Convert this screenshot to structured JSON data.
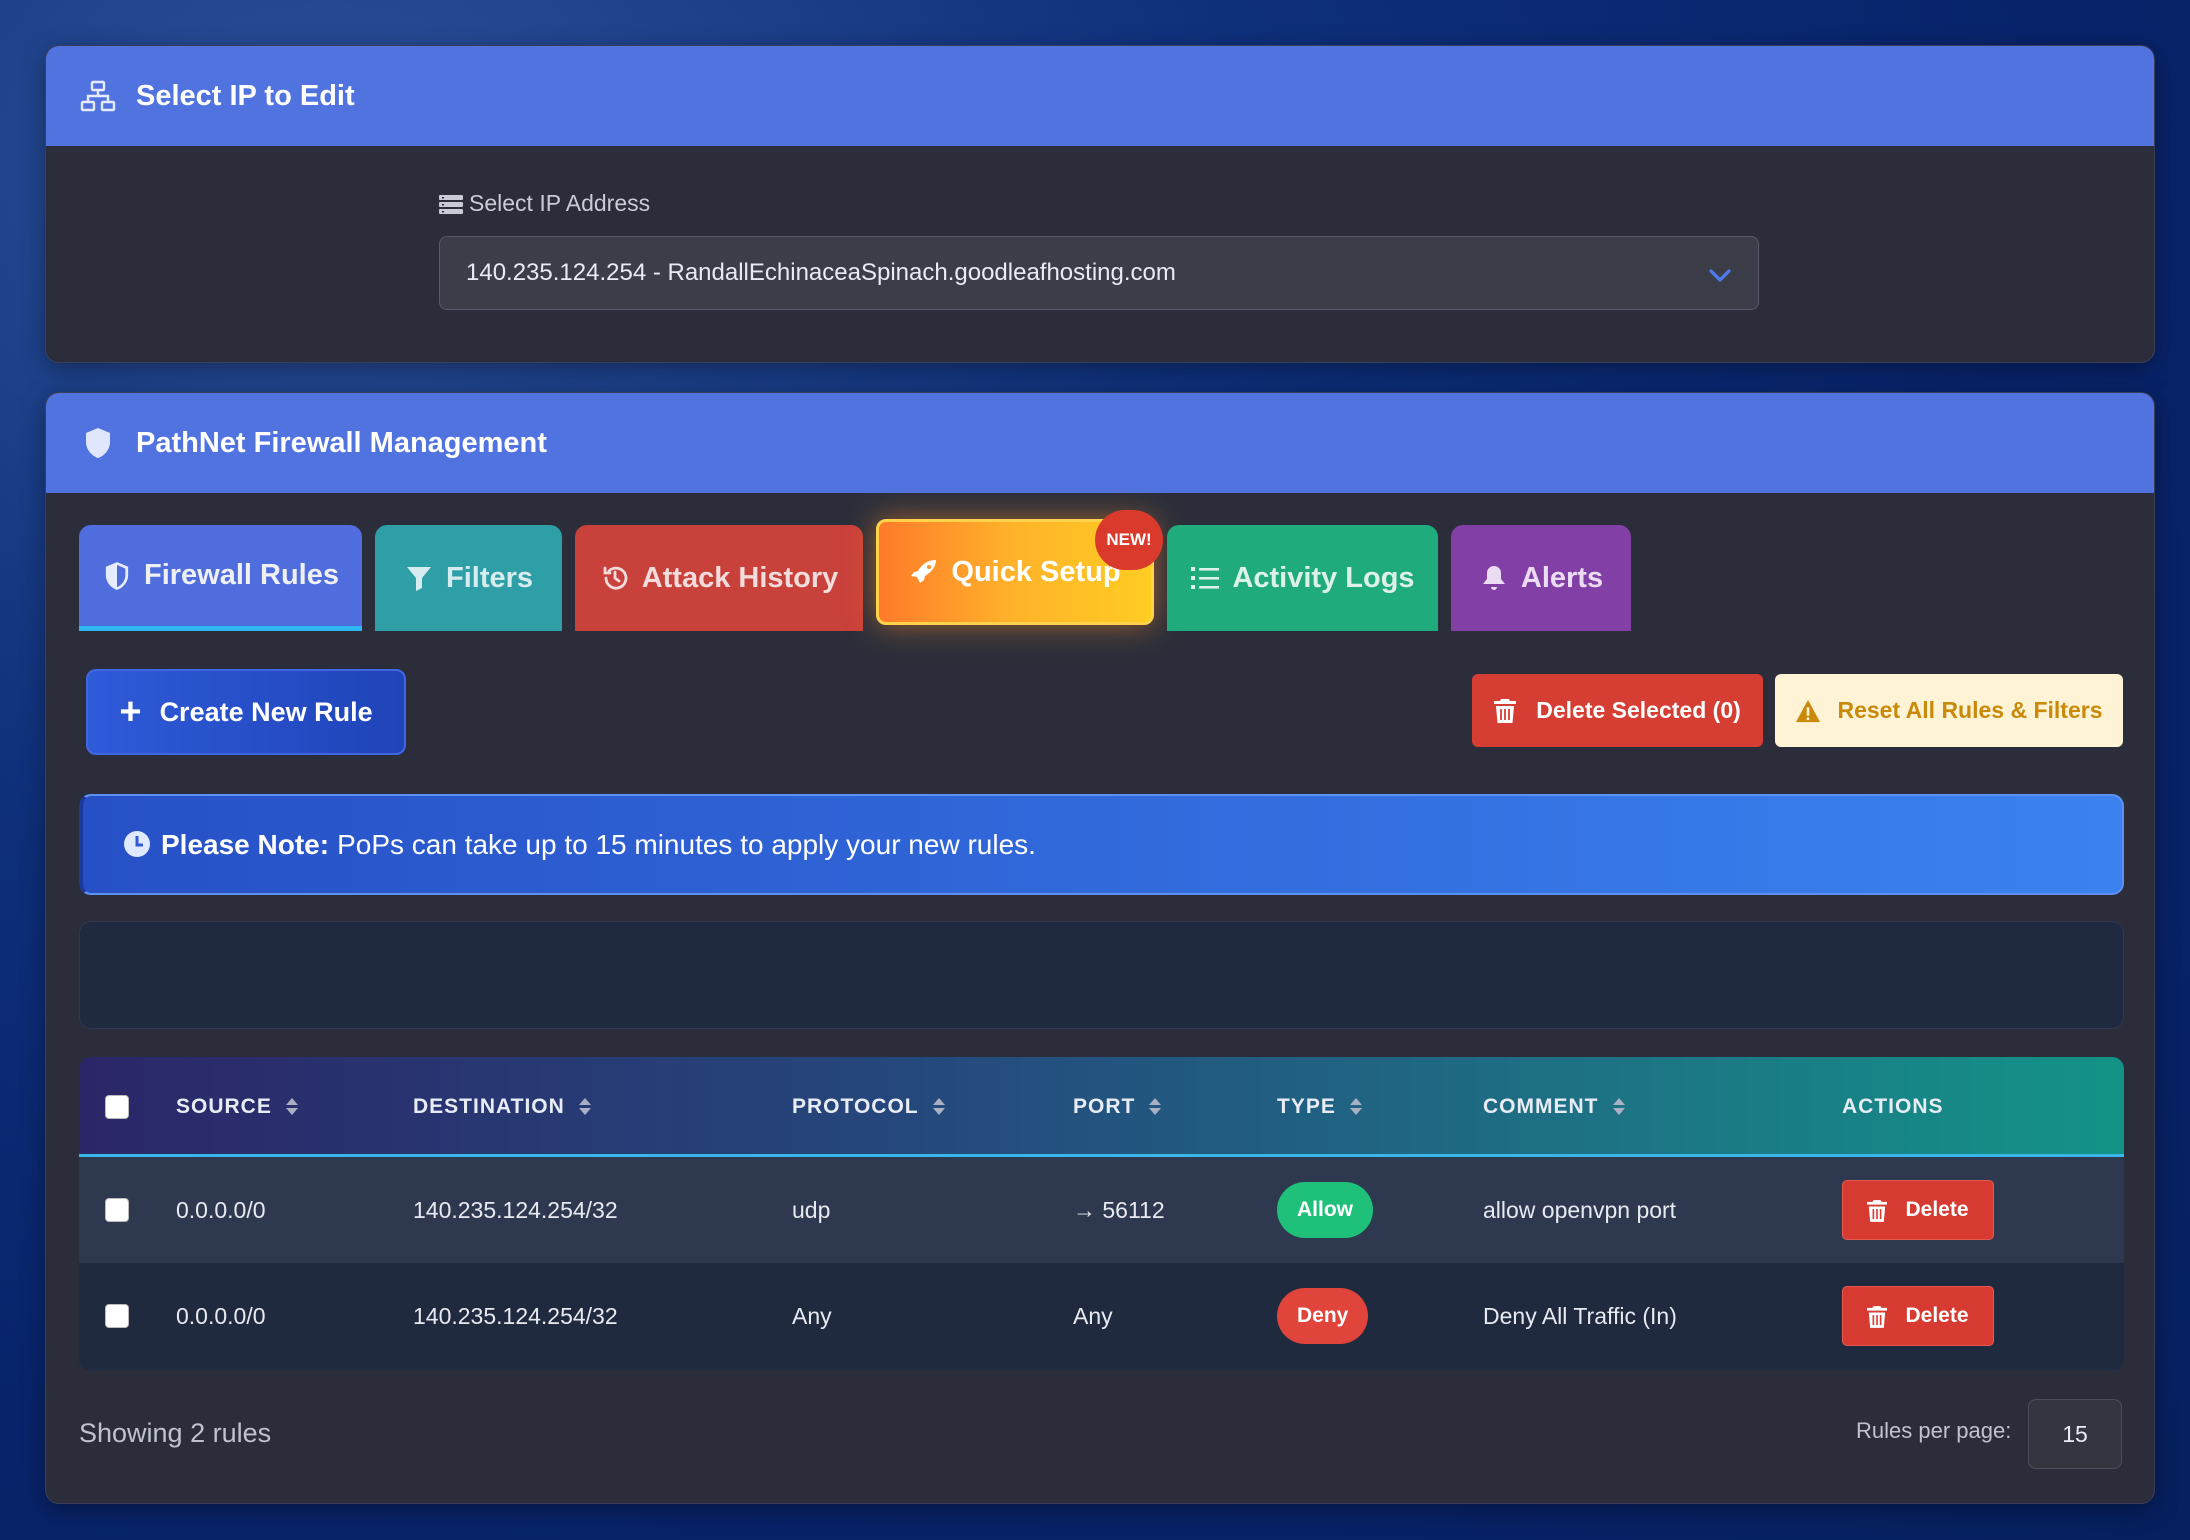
{
  "ip_card": {
    "title": "Select IP to Edit",
    "icon": "network-icon",
    "select_label": "Select IP Address",
    "selected_ip": "140.235.124.254 - RandallEchinaceaSpinach.goodleafhosting.com"
  },
  "firewall_card": {
    "title": "PathNet Firewall Management",
    "icon": "shield-icon",
    "tabs": [
      {
        "label": "Firewall Rules",
        "icon": "shield-icon",
        "active": true
      },
      {
        "label": "Filters",
        "icon": "filter-icon"
      },
      {
        "label": "Attack History",
        "icon": "history-icon"
      },
      {
        "label": "Quick Setup",
        "icon": "rocket-icon",
        "badge": "NEW!"
      },
      {
        "label": "Activity Logs",
        "icon": "list-icon"
      },
      {
        "label": "Alerts",
        "icon": "bell-icon"
      }
    ],
    "create_button": "Create New Rule",
    "delete_selected_button": "Delete Selected (0)",
    "reset_button": "Reset All Rules & Filters",
    "note_bold": "Please Note:",
    "note_text": "PoPs can take up to 15 minutes to apply your new rules.",
    "table": {
      "headers": [
        "SOURCE",
        "DESTINATION",
        "PROTOCOL",
        "PORT",
        "TYPE",
        "COMMENT",
        "ACTIONS"
      ],
      "rows": [
        {
          "source": "0.0.0.0/0",
          "destination": "140.235.124.254/32",
          "protocol": "udp",
          "port": "→ 56112",
          "type": "Allow",
          "comment": "allow openvpn port",
          "action": "Delete"
        },
        {
          "source": "0.0.0.0/0",
          "destination": "140.235.124.254/32",
          "protocol": "Any",
          "port": "Any",
          "type": "Deny",
          "comment": "Deny All Traffic (In)",
          "action": "Delete"
        }
      ]
    },
    "showing_text": "Showing 2 rules",
    "per_page_label": "Rules per page:",
    "per_page_value": "15"
  },
  "colors": {
    "header_blue": "#5173e0",
    "allow_green": "#1fc07a",
    "deny_red": "#e0443a",
    "quick_setup_orange": "#ff9a2a"
  }
}
